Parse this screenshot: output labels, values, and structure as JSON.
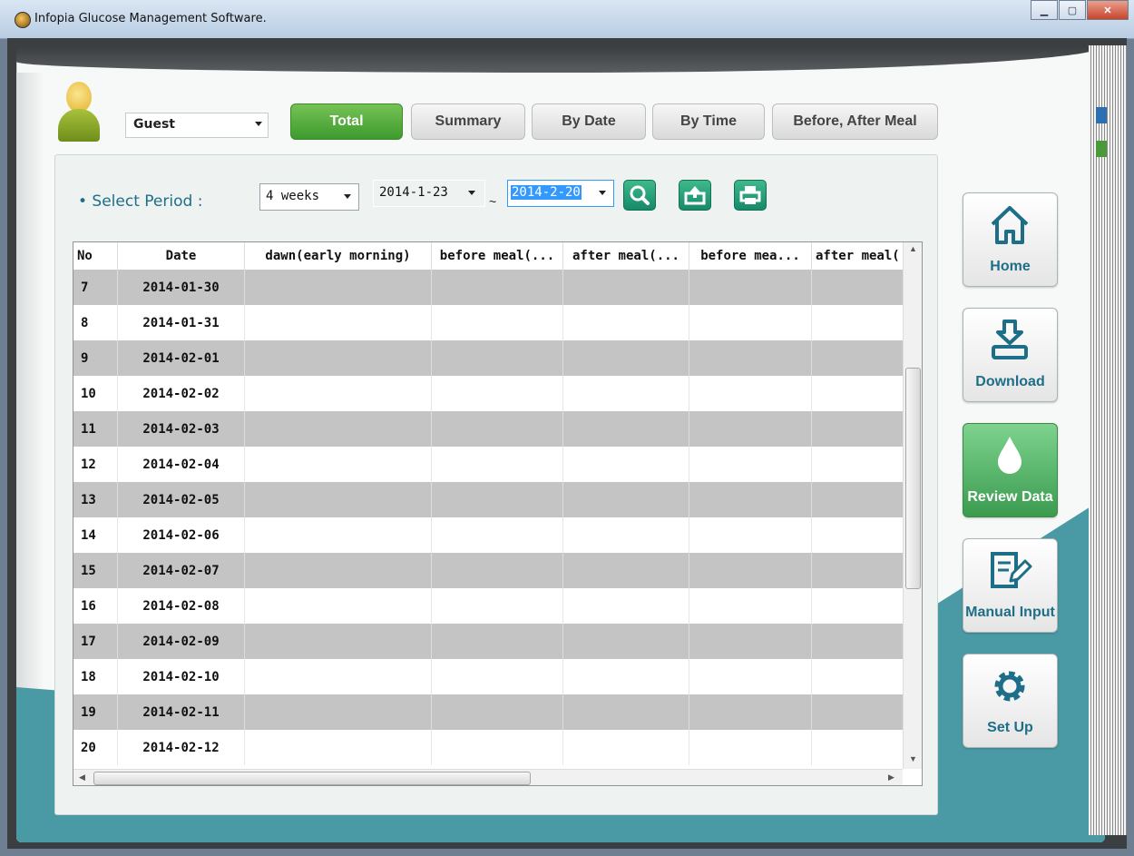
{
  "window": {
    "title": "Infopia Glucose Management Software."
  },
  "user": {
    "selected": "Guest"
  },
  "tabs": [
    "Total",
    "Summary",
    "By Date",
    "By Time",
    "Before, After Meal"
  ],
  "period": {
    "label": "• Select Period :",
    "range_option": "4 weeks",
    "from": "2014-1-23",
    "separator": "~",
    "to": "2014-2-20"
  },
  "table": {
    "columns": [
      "No",
      "Date",
      "dawn(early morning)",
      "before meal(...",
      "after meal(...",
      "before mea...",
      "after meal("
    ],
    "rows": [
      {
        "no": "7",
        "date": "2014-01-30"
      },
      {
        "no": "8",
        "date": "2014-01-31"
      },
      {
        "no": "9",
        "date": "2014-02-01"
      },
      {
        "no": "10",
        "date": "2014-02-02"
      },
      {
        "no": "11",
        "date": "2014-02-03"
      },
      {
        "no": "12",
        "date": "2014-02-04"
      },
      {
        "no": "13",
        "date": "2014-02-05"
      },
      {
        "no": "14",
        "date": "2014-02-06"
      },
      {
        "no": "15",
        "date": "2014-02-07"
      },
      {
        "no": "16",
        "date": "2014-02-08"
      },
      {
        "no": "17",
        "date": "2014-02-09"
      },
      {
        "no": "18",
        "date": "2014-02-10"
      },
      {
        "no": "19",
        "date": "2014-02-11"
      },
      {
        "no": "20",
        "date": "2014-02-12"
      }
    ]
  },
  "nav": {
    "home": "Home",
    "download": "Download",
    "review": "Review Data",
    "manual": "Manual Input",
    "setup": "Set Up"
  },
  "colors": {
    "accent_green": "#3e9a2d",
    "teal": "#4a9aa6",
    "label_blue": "#1d6e88"
  }
}
